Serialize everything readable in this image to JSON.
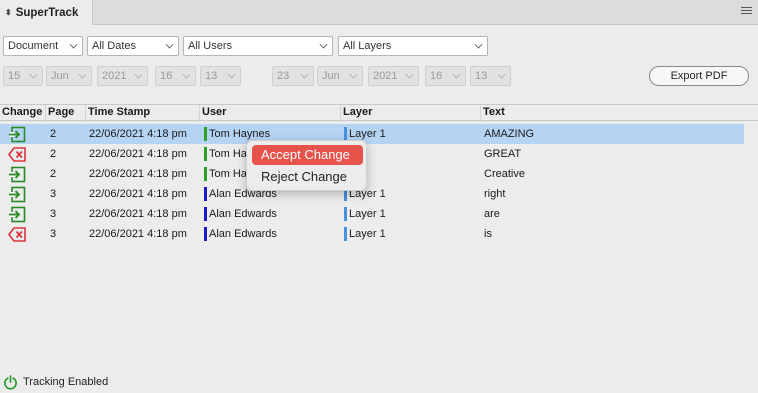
{
  "panel": {
    "title": "SuperTrack",
    "tab_icon": "⬍"
  },
  "filters": {
    "document": "Document",
    "dates": "All Dates",
    "users": "All Users",
    "layers": "All Layers"
  },
  "date_from": {
    "day": "15",
    "month": "Jun",
    "year": "2021",
    "hour": "16",
    "minute": "13"
  },
  "date_to": {
    "day": "23",
    "month": "Jun",
    "year": "2021",
    "hour": "16",
    "minute": "13"
  },
  "export_label": "Export PDF",
  "table": {
    "headers": [
      "Change",
      "Page",
      "Time Stamp",
      "User",
      "Layer",
      "Text"
    ],
    "rows": [
      {
        "change": "accept",
        "page": "2",
        "timestamp": "22/06/2021 4:18 pm",
        "user": "Tom Haynes",
        "user_color": "#2aa02a",
        "layer": "Layer 1",
        "text": "AMAZING",
        "selected": true
      },
      {
        "change": "reject",
        "page": "2",
        "timestamp": "22/06/2021 4:18 pm",
        "user": "Tom Ha",
        "user_color": "#2aa02a",
        "layer": "r 1",
        "text": "GREAT",
        "selected": false
      },
      {
        "change": "accept",
        "page": "2",
        "timestamp": "22/06/2021 4:18 pm",
        "user": "Tom Ha",
        "user_color": "#2aa02a",
        "layer": "r 1",
        "text": " Creative",
        "selected": false
      },
      {
        "change": "accept",
        "page": "3",
        "timestamp": "22/06/2021 4:18 pm",
        "user": "Alan Edwards",
        "user_color": "#1a1acc",
        "layer": "Layer 1",
        "text": "right",
        "selected": false
      },
      {
        "change": "accept",
        "page": "3",
        "timestamp": "22/06/2021 4:18 pm",
        "user": "Alan Edwards",
        "user_color": "#1a1acc",
        "layer": "Layer 1",
        "text": "are",
        "selected": false
      },
      {
        "change": "reject",
        "page": "3",
        "timestamp": "22/06/2021 4:18 pm",
        "user": "Alan Edwards",
        "user_color": "#1a1acc",
        "layer": "Layer 1",
        "text": "is",
        "selected": false
      }
    ]
  },
  "context_menu": {
    "accept": "Accept Change",
    "reject": "Reject Change"
  },
  "status": {
    "text": "Tracking Enabled"
  },
  "colors": {
    "accept_icon": "#2a8a2a",
    "reject_icon": "#d9343c",
    "selection": "#b5d4f4",
    "menu_highlight": "#e5534b",
    "layer_bar": "#4a90e2"
  }
}
